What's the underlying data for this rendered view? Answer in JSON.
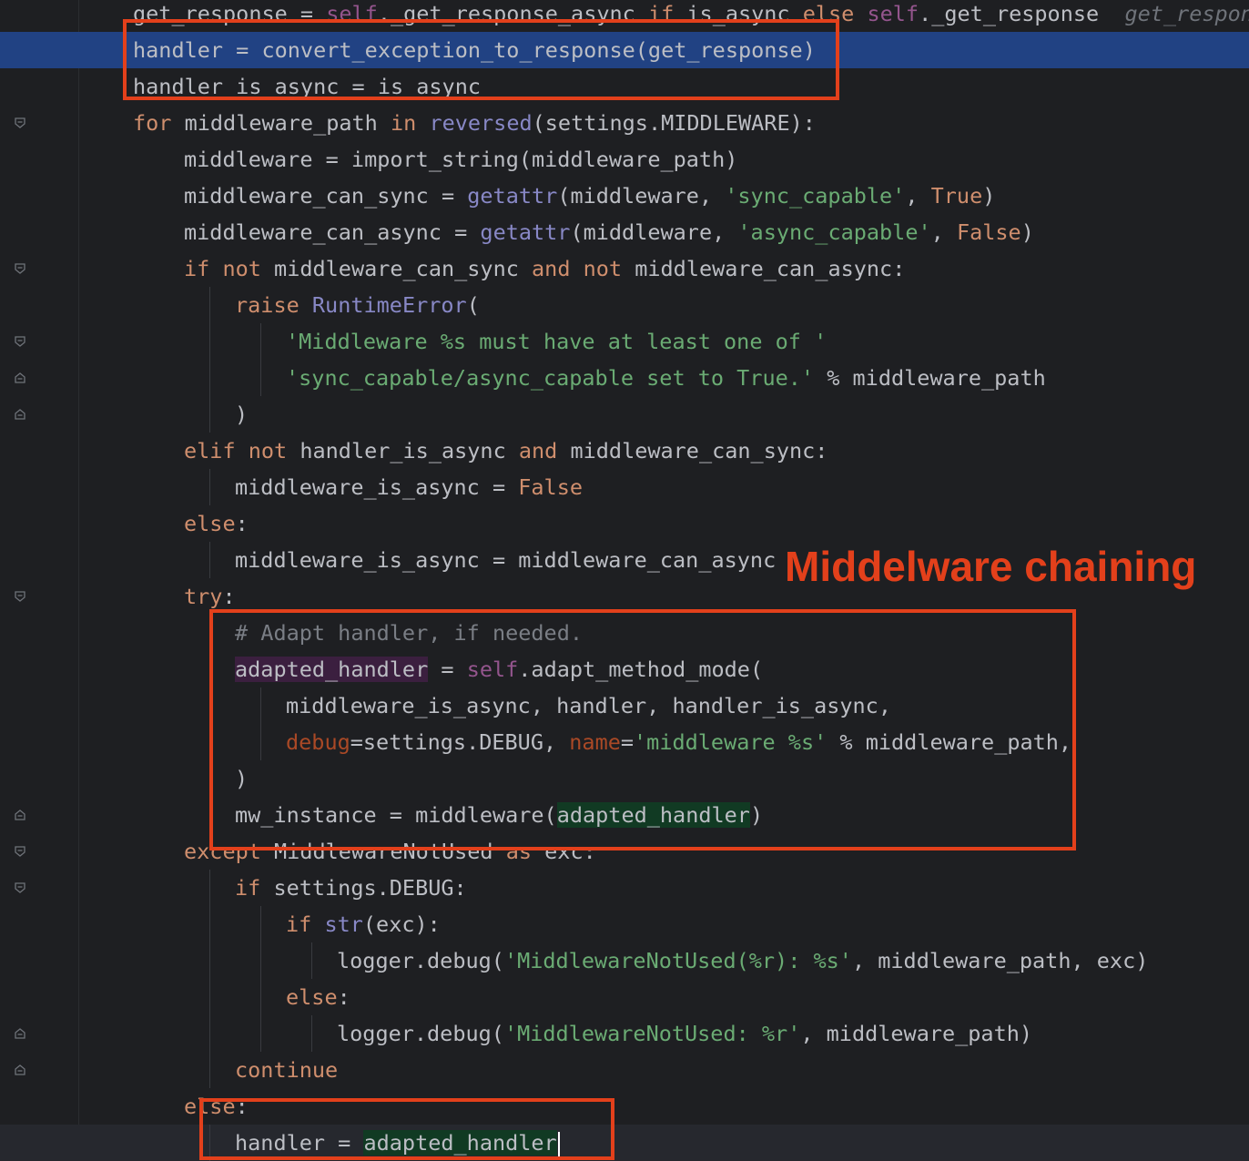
{
  "editor": {
    "lines": [
      {
        "segments": [
          {
            "t": "get_response = "
          },
          {
            "t": "self",
            "c": "self"
          },
          {
            "t": "._get_response_async "
          },
          {
            "t": "if",
            "c": "kw"
          },
          {
            "t": " is_async "
          },
          {
            "t": "else",
            "c": "kw"
          },
          {
            "t": " "
          },
          {
            "t": "self",
            "c": "self"
          },
          {
            "t": "._get_response  "
          },
          {
            "t": "get_respons",
            "c": "hint"
          }
        ]
      },
      {
        "segments": [
          {
            "t": "handler = convert_exception_to_response(get_response)"
          }
        ]
      },
      {
        "segments": [
          {
            "t": "handler_is_async = is_async"
          }
        ]
      },
      {
        "segments": [
          {
            "t": "for",
            "c": "kw"
          },
          {
            "t": " middleware_path "
          },
          {
            "t": "in",
            "c": "kw"
          },
          {
            "t": " "
          },
          {
            "t": "reversed",
            "c": "bi"
          },
          {
            "t": "(settings.MIDDLEWARE):"
          }
        ]
      },
      {
        "segments": [
          {
            "t": "middleware = import_string(middleware_path)"
          }
        ]
      },
      {
        "segments": [
          {
            "t": "middleware_can_sync = "
          },
          {
            "t": "getattr",
            "c": "bi"
          },
          {
            "t": "(middleware, "
          },
          {
            "t": "'sync_capable'",
            "c": "str"
          },
          {
            "t": ", "
          },
          {
            "t": "True",
            "c": "kw"
          },
          {
            "t": ")"
          }
        ]
      },
      {
        "segments": [
          {
            "t": "middleware_can_async = "
          },
          {
            "t": "getattr",
            "c": "bi"
          },
          {
            "t": "(middleware, "
          },
          {
            "t": "'async_capable'",
            "c": "str"
          },
          {
            "t": ", "
          },
          {
            "t": "False",
            "c": "kw"
          },
          {
            "t": ")"
          }
        ]
      },
      {
        "segments": [
          {
            "t": "if",
            "c": "kw"
          },
          {
            "t": " "
          },
          {
            "t": "not",
            "c": "kw"
          },
          {
            "t": " middleware_can_sync "
          },
          {
            "t": "and",
            "c": "kw"
          },
          {
            "t": " "
          },
          {
            "t": "not",
            "c": "kw"
          },
          {
            "t": " middleware_can_async:"
          }
        ]
      },
      {
        "segments": [
          {
            "t": "raise",
            "c": "kw"
          },
          {
            "t": " "
          },
          {
            "t": "RuntimeError",
            "c": "cls"
          },
          {
            "t": "("
          }
        ]
      },
      {
        "segments": [
          {
            "t": "'Middleware %s must have at least one of '",
            "c": "str"
          }
        ]
      },
      {
        "segments": [
          {
            "t": "'sync_capable/async_capable set to True.'",
            "c": "str"
          },
          {
            "t": " % middleware_path"
          }
        ]
      },
      {
        "segments": [
          {
            "t": ")"
          }
        ]
      },
      {
        "segments": [
          {
            "t": "elif",
            "c": "kw"
          },
          {
            "t": " "
          },
          {
            "t": "not",
            "c": "kw"
          },
          {
            "t": " handler_is_async "
          },
          {
            "t": "and",
            "c": "kw"
          },
          {
            "t": " middleware_can_sync:"
          }
        ]
      },
      {
        "segments": [
          {
            "t": "middleware_is_async = "
          },
          {
            "t": "False",
            "c": "kw"
          }
        ]
      },
      {
        "segments": [
          {
            "t": "else",
            "c": "kw"
          },
          {
            "t": ":"
          }
        ]
      },
      {
        "segments": [
          {
            "t": "middleware_is_async = middleware_can_async"
          }
        ]
      },
      {
        "segments": [
          {
            "t": "try",
            "c": "kw"
          },
          {
            "t": ":"
          }
        ]
      },
      {
        "segments": [
          {
            "t": "# Adapt handler, if needed.",
            "c": "cmt"
          }
        ]
      },
      {
        "segments": [
          {
            "t": "adapted_handler",
            "c": "usage"
          },
          {
            "t": " = "
          },
          {
            "t": "self",
            "c": "self"
          },
          {
            "t": ".adapt_method_mode("
          }
        ]
      },
      {
        "segments": [
          {
            "t": "middleware_is_async, handler, handler_is_async,"
          }
        ]
      },
      {
        "segments": [
          {
            "t": "debug",
            "c": "param"
          },
          {
            "t": "=settings.DEBUG, "
          },
          {
            "t": "name",
            "c": "param"
          },
          {
            "t": "="
          },
          {
            "t": "'middleware %s'",
            "c": "str"
          },
          {
            "t": " % middleware_path,"
          }
        ]
      },
      {
        "segments": [
          {
            "t": ")"
          }
        ]
      },
      {
        "segments": [
          {
            "t": "mw_instance = middleware("
          },
          {
            "t": "adapted_handler",
            "c": "usage2"
          },
          {
            "t": ")"
          }
        ]
      },
      {
        "segments": [
          {
            "t": "except",
            "c": "kw"
          },
          {
            "t": " MiddlewareNotUsed "
          },
          {
            "t": "as",
            "c": "kw"
          },
          {
            "t": " exc:"
          }
        ]
      },
      {
        "segments": [
          {
            "t": "if",
            "c": "kw"
          },
          {
            "t": " settings.DEBUG:"
          }
        ]
      },
      {
        "segments": [
          {
            "t": "if",
            "c": "kw"
          },
          {
            "t": " "
          },
          {
            "t": "str",
            "c": "bi"
          },
          {
            "t": "(exc):"
          }
        ]
      },
      {
        "segments": [
          {
            "t": "logger.debug("
          },
          {
            "t": "'MiddlewareNotUsed(%r): %s'",
            "c": "str"
          },
          {
            "t": ", middleware_path, exc)"
          }
        ]
      },
      {
        "segments": [
          {
            "t": "else",
            "c": "kw"
          },
          {
            "t": ":"
          }
        ]
      },
      {
        "segments": [
          {
            "t": "logger.debug("
          },
          {
            "t": "'MiddlewareNotUsed: %r'",
            "c": "str"
          },
          {
            "t": ", middleware_path)"
          }
        ]
      },
      {
        "segments": [
          {
            "t": "continue",
            "c": "kw"
          }
        ]
      },
      {
        "segments": [
          {
            "t": "else",
            "c": "kw"
          },
          {
            "t": ":"
          }
        ]
      },
      {
        "segments": [
          {
            "t": "handler = "
          },
          {
            "t": "adapted_handler",
            "c": "usage2"
          }
        ]
      }
    ]
  },
  "annotation": {
    "label": "Middelware chaining",
    "color": "#e3401b"
  },
  "colors": {
    "background": "#1e1f22",
    "selection": "#214283",
    "keyword": "#cf8e6d",
    "string": "#6aab73",
    "builtin": "#8888c6",
    "self": "#94558d",
    "comment": "#7a7e85",
    "annotation_red": "#e3401b"
  },
  "icons": {
    "fold_open": "fold-open-icon",
    "fold_close": "fold-close-icon"
  }
}
